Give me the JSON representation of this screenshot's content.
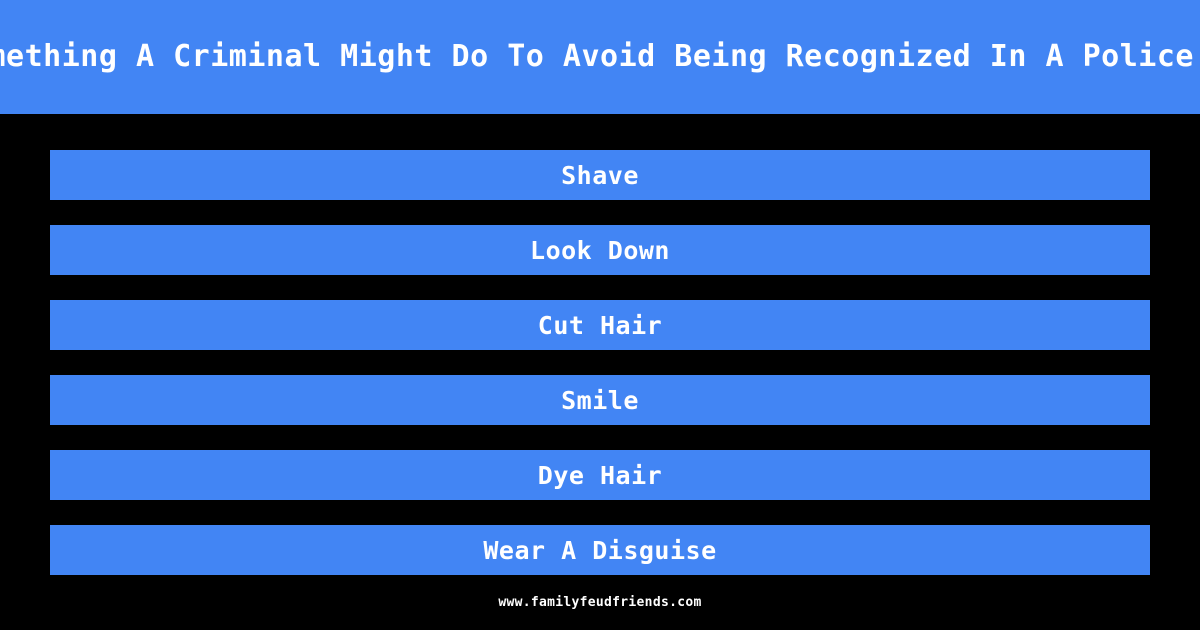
{
  "theme": {
    "background_color": "#000000",
    "accent_color": "#4285f4",
    "text_color": "#ffffff"
  },
  "header": {
    "question": "Name Something A Criminal Might Do To Avoid Being Recognized In A Police Line-Up"
  },
  "answers": [
    {
      "rank": 1,
      "label": "Shave"
    },
    {
      "rank": 2,
      "label": "Look Down"
    },
    {
      "rank": 3,
      "label": "Cut Hair"
    },
    {
      "rank": 4,
      "label": "Smile"
    },
    {
      "rank": 5,
      "label": "Dye Hair"
    },
    {
      "rank": 6,
      "label": "Wear A Disguise"
    }
  ],
  "footer": {
    "site": "www.familyfeudfriends.com"
  }
}
